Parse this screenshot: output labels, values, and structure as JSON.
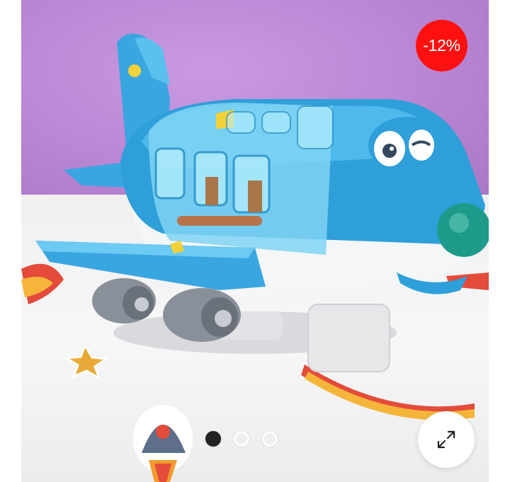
{
  "product_gallery": {
    "discount_badge": "-12%",
    "slide_count": 3,
    "active_slide": 1,
    "colors": {
      "badge": "#ff1010",
      "dot_active": "#222222",
      "dot_inactive": "#ffffff"
    },
    "icons": {
      "expand": "expand-arrows-icon"
    }
  }
}
